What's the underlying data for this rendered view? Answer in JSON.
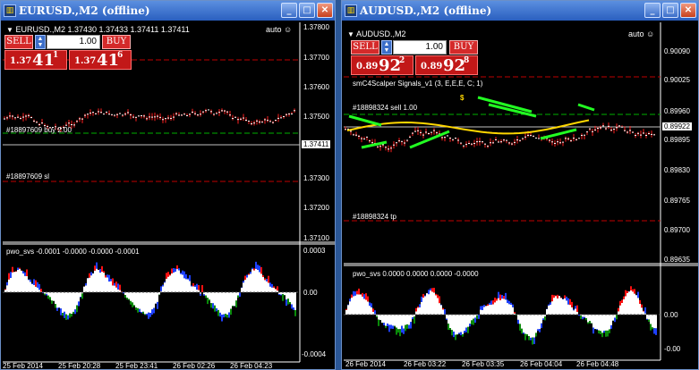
{
  "window1": {
    "title": "EURUSD.,M2 (offline)",
    "symbol": "EURUSD.,M2",
    "ohlc": "1.37430 1.37433 1.37411 1.37411",
    "auto": "auto",
    "sell_label": "SELL",
    "buy_label": "BUY",
    "lot": "1.00",
    "sell_price": {
      "small": "1.37",
      "big": "41",
      "sup": "1"
    },
    "buy_price": {
      "small": "1.37",
      "big": "41",
      "sup": "6"
    },
    "order_buy_label": "#18897609 buy 2.00",
    "order_sl_label": "#18897609 sl",
    "current_price": "1.37411",
    "price_axis": [
      "1.37800",
      "1.37700",
      "1.37600",
      "1.37500",
      "1.37300",
      "1.37200",
      "1.37100"
    ],
    "indicator_label": "pwo_svs -0.0001 -0.0000 -0.0000 -0.0001",
    "ind_axis": [
      "0.0003",
      "0.00",
      "-0.0004"
    ],
    "time_axis": [
      "25 Feb 2014",
      "25 Feb 20:28",
      "25 Feb 23:41",
      "26 Feb 02:26",
      "26 Feb 04:23"
    ]
  },
  "window2": {
    "title": "AUDUSD.,M2 (offline)",
    "symbol": "AUDUSD.,M2",
    "auto": "auto",
    "sell_label": "SELL",
    "buy_label": "BUY",
    "lot": "1.00",
    "sell_price": {
      "small": "0.89",
      "big": "92",
      "sup": "2"
    },
    "buy_price": {
      "small": "0.89",
      "big": "92",
      "sup": "8"
    },
    "signals_label": "smC4Scalper Signals_v1 (3, E,E,E, C; 1)",
    "dollar_mark": "$",
    "order_sell_label": "#18898324 sell 1.00",
    "order_tp_label": "#18898324 tp",
    "current_price": "0.89922",
    "price_axis": [
      "0.90090",
      "0.90025",
      "0.89960",
      "0.89895",
      "0.89830",
      "0.89765",
      "0.89700",
      "0.89635"
    ],
    "indicator_label": "pwo_svs 0.0000 0.0000 0.0000 -0.0000",
    "ind_axis": [
      "0.00",
      "-0.00"
    ],
    "time_axis": [
      "26 Feb 2014",
      "26 Feb 03:22",
      "26 Feb 03:35",
      "26 Feb 04:04",
      "26 Feb 04:48"
    ]
  },
  "colors": {
    "candle": "#ff0000",
    "green": "#00ff00",
    "yellow": "#ffd700",
    "blue": "#1e40ff",
    "red": "#ff0000",
    "white": "#ffffff"
  }
}
